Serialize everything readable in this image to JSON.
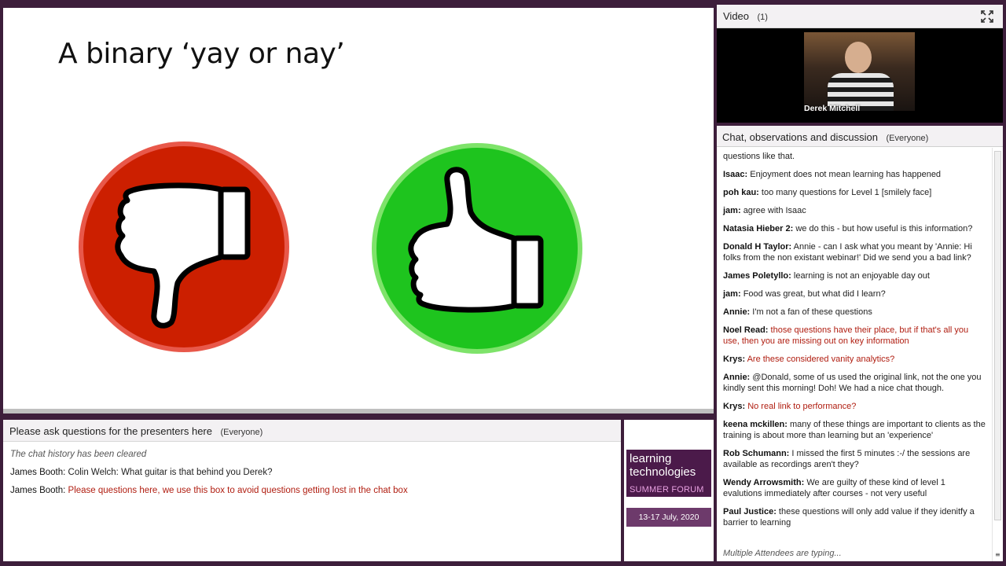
{
  "slide": {
    "title": "A binary ‘yay or nay’",
    "colors": {
      "down_circle": "#cc1f00",
      "down_ring": "#e8584a",
      "up_circle": "#1ec41e",
      "up_ring": "#7ee36a"
    }
  },
  "questions": {
    "title": "Please ask questions for the presenters here",
    "scope": "(Everyone)",
    "cleared": "The chat history has been cleared",
    "messages": [
      {
        "sender": "James Booth:",
        "text": "Colin Welch: What guitar is that behind you Derek?",
        "highlight": false
      },
      {
        "sender": "James Booth:",
        "text": "Please questions here, we use this box to avoid questions getting lost in the chat box",
        "highlight": true
      }
    ]
  },
  "logo": {
    "line1": "learning",
    "line2": "technologies",
    "line3": "SUMMER FORUM",
    "date": "13-17 July, 2020"
  },
  "video": {
    "title": "Video",
    "count": "(1)",
    "presenter_name": "Derek Mitchell"
  },
  "chat": {
    "title": "Chat, observations and discussion",
    "scope": "(Everyone)",
    "messages": [
      {
        "sender": "",
        "text": "questions like that.",
        "highlight": false
      },
      {
        "sender": "Isaac:",
        "text": "Enjoyment does not mean learning has happened",
        "highlight": false
      },
      {
        "sender": "poh kau:",
        "text": "too many questions for Level 1 [smilely face]",
        "highlight": false
      },
      {
        "sender": "jam:",
        "text": "agree with Isaac",
        "highlight": false
      },
      {
        "sender": "Natasia Hieber 2:",
        "text": "we do this - but how useful is this information?",
        "highlight": false
      },
      {
        "sender": "Donald H Taylor:",
        "text": "Annie - can I ask what you meant by 'Annie: Hi folks from the non existant webinar!' Did we send you a bad link?",
        "highlight": false
      },
      {
        "sender": "James Poletyllo:",
        "text": "learning is not an enjoyable day out",
        "highlight": false
      },
      {
        "sender": "jam:",
        "text": "Food was great, but what did I learn?",
        "highlight": false
      },
      {
        "sender": "Annie:",
        "text": "I'm not a fan of these questions",
        "highlight": false
      },
      {
        "sender": "Noel Read:",
        "text": "those questions have their place, but  if that's all you use, then you are missing out on key information",
        "highlight": true
      },
      {
        "sender": "Krys:",
        "text": "Are these  considered vanity analytics?",
        "highlight": true
      },
      {
        "sender": "Annie:",
        "text": "@Donald, some of us used the original link, not the one you kindly sent this morning! Doh! We had a nice chat though.",
        "highlight": false
      },
      {
        "sender": "Krys:",
        "text": "No real link to performance?",
        "highlight": true
      },
      {
        "sender": "keena mckillen:",
        "text": "many of these things are important to clients as the training is about more than learning but an 'experience'",
        "highlight": false
      },
      {
        "sender": "Rob Schumann:",
        "text": "I missed the first 5 minutes :-/ the sessions are available as recordings aren't they?",
        "highlight": false
      },
      {
        "sender": "Wendy Arrowsmith:",
        "text": "We are guilty of these kind of level 1 evalutions immediately after courses - not very useful",
        "highlight": false
      },
      {
        "sender": "Paul Justice:",
        "text": "these questions will only add value if they idenitfy a barrier to learning",
        "highlight": false
      }
    ],
    "typing": "Multiple Attendees are typing..."
  }
}
